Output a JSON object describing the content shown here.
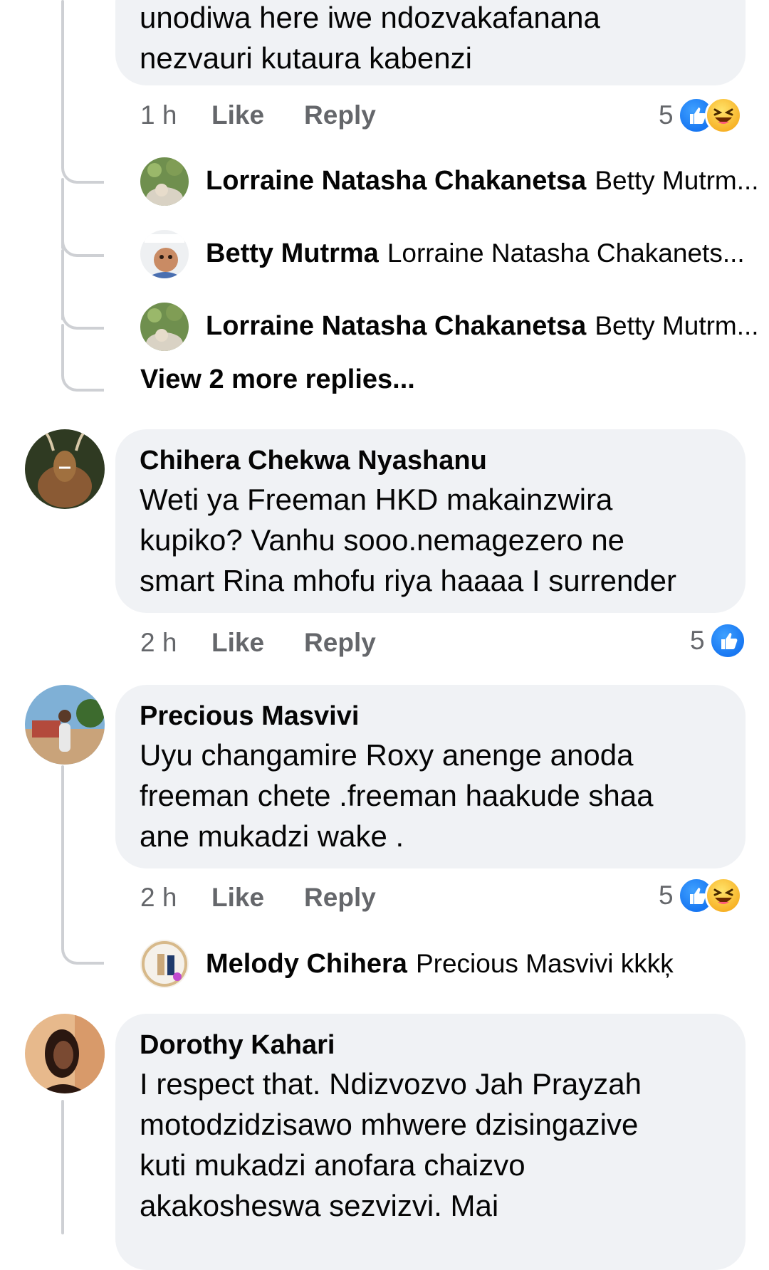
{
  "colors": {
    "bubble": "#f0f2f5",
    "meta": "#65676b",
    "text": "#050505",
    "thread": "#ced0d4",
    "like_blue": "#1877f2",
    "haha_yellow": "#f7b125"
  },
  "top_comment": {
    "body_lines": [
      "unodiwa here iwe ndozvakafanana",
      "nezvauri kutaura kabenzi"
    ],
    "time": "1 h",
    "like_label": "Like",
    "reply_label": "Reply",
    "reaction_count": "5",
    "reaction_icons": [
      "like-icon",
      "haha-icon"
    ],
    "replies": [
      {
        "author": "Lorraine Natasha Chakanetsa",
        "snippet": "Betty Mutrm..."
      },
      {
        "author": "Betty Mutrma",
        "snippet": "Lorraine Natasha Chakanets..."
      },
      {
        "author": "Lorraine Natasha Chakanetsa",
        "snippet": "Betty Mutrm..."
      }
    ],
    "view_more": "View 2 more replies..."
  },
  "comment_chihera": {
    "author": "Chihera Chekwa Nyashanu",
    "body_lines": [
      "Weti ya Freeman HKD  makainzwira",
      "kupiko? Vanhu sooo.nemagezero  ne",
      "smart Rina mhofu riya  haaaa I surrender"
    ],
    "time": "2 h",
    "like_label": "Like",
    "reply_label": "Reply",
    "reaction_count": "5",
    "reaction_icons": [
      "like-icon"
    ]
  },
  "comment_precious": {
    "author": "Precious Masvivi",
    "body_lines": [
      "Uyu changamire Roxy anenge anoda",
      "freeman chete .freeman haakude shaa",
      "ane mukadzi wake ."
    ],
    "time": "2 h",
    "like_label": "Like",
    "reply_label": "Reply",
    "reaction_count": "5",
    "reaction_icons": [
      "like-icon",
      "haha-icon"
    ],
    "replies": [
      {
        "author": "Melody Chihera",
        "snippet": "Precious Masvivi kkkķ"
      }
    ]
  },
  "comment_dorothy": {
    "author": "Dorothy Kahari",
    "body_lines": [
      "I respect that. Ndizvozvo Jah Prayzah",
      "motodzidzisawo mhwere dzisingazive",
      "kuti mukadzi anofara chaizvo",
      "akakosheswa sezvizvi. Mai"
    ]
  }
}
